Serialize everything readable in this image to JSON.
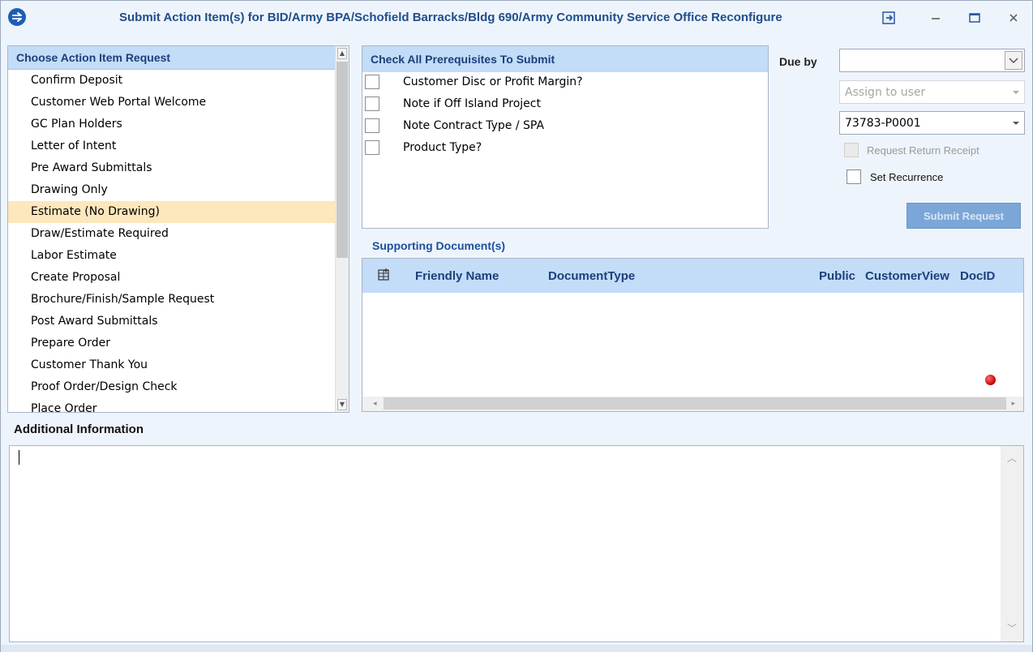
{
  "window": {
    "title": "Submit Action Item(s) for BID/Army BPA/Schofield Barracks/Bldg 690/Army Community Service Office Reconfigure"
  },
  "action_list": {
    "header": "Choose Action Item Request",
    "items": [
      "Confirm Deposit",
      "Customer Web Portal Welcome",
      "GC Plan Holders",
      "Letter of Intent",
      "Pre Award Submittals",
      "Drawing Only",
      "Estimate (No Drawing)",
      "Draw/Estimate Required",
      "Labor Estimate",
      "Create Proposal",
      "Brochure/Finish/Sample Request",
      "Post Award Submittals",
      "Prepare Order",
      "Customer Thank You",
      "Proof Order/Design Check",
      "Place Order"
    ],
    "selected": "Estimate (No Drawing)"
  },
  "prerequisites": {
    "header": "Check All Prerequisites To Submit",
    "items": [
      "Customer Disc or Profit Margin?",
      "Note if Off Island Project",
      "Note Contract Type / SPA",
      "Product Type?"
    ]
  },
  "form": {
    "due_by_label": "Due by",
    "due_by_value": "",
    "assign_placeholder": "Assign to user",
    "project_value": "73783-P0001",
    "return_receipt_label": "Request Return Receipt",
    "recurrence_label": "Set Recurrence",
    "submit_label": "Submit Request"
  },
  "documents": {
    "title": "Supporting Document(s)",
    "columns": [
      "Friendly Name",
      "DocumentType",
      "Public",
      "CustomerView",
      "DocID"
    ]
  },
  "additional_info": {
    "label": "Additional Information",
    "value": ""
  },
  "colors": {
    "accent": "#1f4e8c",
    "header_bg": "#c3dcf7",
    "selected_bg": "#fde7bd",
    "submit_bg": "#7ba6d8"
  }
}
